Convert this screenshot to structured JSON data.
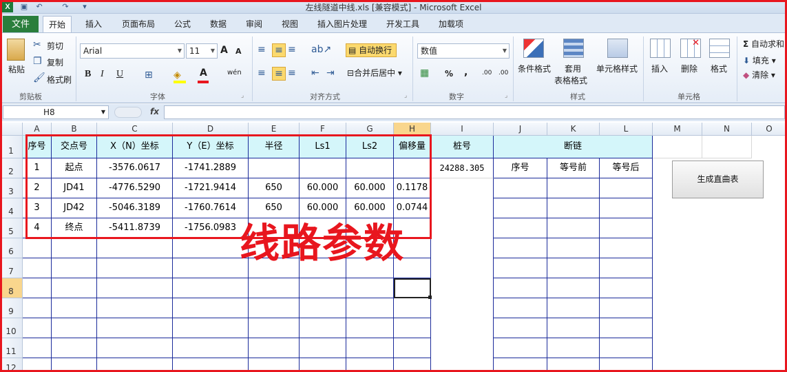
{
  "window": {
    "title": "左线隧道中线.xls  [兼容模式]  -  Microsoft Excel"
  },
  "ribbon_tabs": [
    "文件",
    "开始",
    "插入",
    "页面布局",
    "公式",
    "数据",
    "审阅",
    "视图",
    "插入图片处理",
    "开发工具",
    "加载项"
  ],
  "clipboard": {
    "paste": "粘贴",
    "cut": "剪切",
    "copy": "复制",
    "format_painter": "格式刷",
    "label": "剪贴板"
  },
  "font": {
    "name": "Arial",
    "size": "11",
    "label": "字体",
    "bold": "B",
    "italic": "I",
    "underline": "U",
    "grow": "A",
    "shrink": "A",
    "phonetic": "wén"
  },
  "alignment": {
    "wrap_text": "自动换行",
    "merge_center": "合并后居中",
    "label": "对齐方式"
  },
  "number": {
    "format": "数值",
    "label": "数字",
    "percent": "%",
    "comma": ",",
    "inc_decimal": ".00",
    "dec_decimal": ".00"
  },
  "styles": {
    "conditional": "条件格式",
    "table_format_1": "套用",
    "table_format_2": "表格格式",
    "cell_styles": "单元格样式",
    "label": "样式"
  },
  "cells": {
    "insert": "插入",
    "delete": "删除",
    "format": "格式",
    "label": "单元格"
  },
  "editing": {
    "autosum": "自动求和",
    "fill": "填充",
    "clear": "清除"
  },
  "formula_bar": {
    "name_box": "H8",
    "fx": "fx",
    "value": ""
  },
  "columns": [
    "A",
    "B",
    "C",
    "D",
    "E",
    "F",
    "G",
    "H",
    "I",
    "J",
    "K",
    "L",
    "M",
    "N",
    "O"
  ],
  "rows": [
    "1",
    "2",
    "3",
    "4",
    "5",
    "6",
    "7",
    "8",
    "9",
    "10",
    "11",
    "12"
  ],
  "table": {
    "headers": [
      "序号",
      "交点号",
      "X（N）坐标",
      "Y（E）坐标",
      "半径",
      "Ls1",
      "Ls2",
      "偏移量"
    ],
    "rows": [
      [
        "1",
        "起点",
        "-3576.0617",
        "-1741.2889",
        "",
        "",
        "",
        ""
      ],
      [
        "2",
        "JD41",
        "-4776.5290",
        "-1721.9414",
        "650",
        "60.000",
        "60.000",
        "0.1178"
      ],
      [
        "3",
        "JD42",
        "-5046.3189",
        "-1760.7614",
        "650",
        "60.000",
        "60.000",
        "0.0744"
      ],
      [
        "4",
        "终点",
        "-5411.8739",
        "-1756.0983",
        "",
        "",
        "",
        ""
      ]
    ]
  },
  "station": {
    "header": "桩号",
    "value": "24288.305"
  },
  "chain_break": {
    "header": "断链",
    "subheaders": [
      "序号",
      "等号前",
      "等号后"
    ]
  },
  "generate_button": "生成直曲表",
  "overlay_caption": "线路参数",
  "colors": {
    "header_fill": "#d4f6fa",
    "grid_border": "#1a2a9a",
    "annotation_red": "#e8161e"
  }
}
